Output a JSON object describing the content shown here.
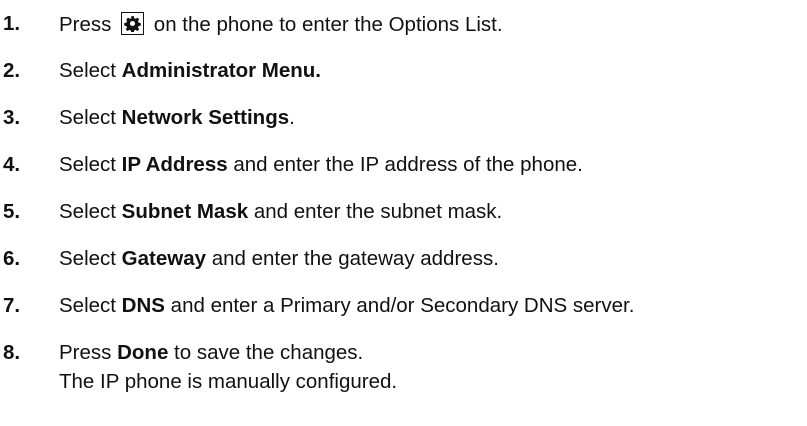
{
  "steps": [
    {
      "num": "1.",
      "before": "Press",
      "icon": "gear-icon",
      "after": "on the phone to enter the Options List."
    },
    {
      "num": "2.",
      "pre": "Select ",
      "bold": "Administrator Menu.",
      "post": ""
    },
    {
      "num": "3.",
      "pre": "Select ",
      "bold": "Network Settings",
      "post": "."
    },
    {
      "num": "4.",
      "pre": "Select ",
      "bold": "IP Address",
      "post": " and enter the IP address of the phone."
    },
    {
      "num": "5.",
      "pre": "Select ",
      "bold": "Subnet Mask",
      "post": " and enter the subnet mask."
    },
    {
      "num": "6.",
      "pre": "Select ",
      "bold": "Gateway",
      "post": " and enter the gateway address."
    },
    {
      "num": "7.",
      "pre": "Select ",
      "bold": "DNS",
      "post": " and enter a Primary and/or Secondary DNS server."
    },
    {
      "num": "8.",
      "pre": "Press ",
      "bold": "Done",
      "post": " to save the changes.",
      "line2": "The IP phone is manually configured."
    }
  ]
}
